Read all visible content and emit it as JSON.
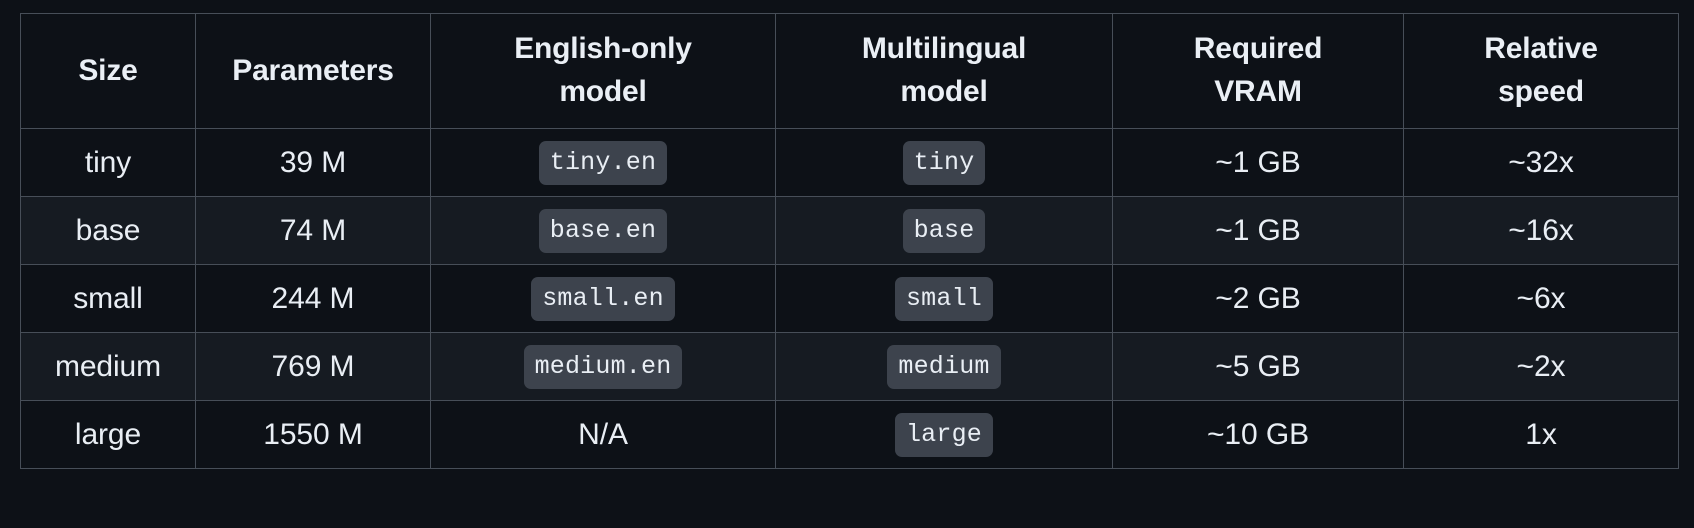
{
  "table": {
    "columns": [
      {
        "key": "size",
        "label": "Size"
      },
      {
        "key": "parameters",
        "label": "Parameters"
      },
      {
        "key": "english",
        "label": "English-only\nmodel",
        "line1": "English-only",
        "line2": "model"
      },
      {
        "key": "multilingual",
        "label": "Multilingual\nmodel",
        "line1": "Multilingual",
        "line2": "model"
      },
      {
        "key": "vram",
        "label": "Required\nVRAM",
        "line1": "Required",
        "line2": "VRAM"
      },
      {
        "key": "speed",
        "label": "Relative\nspeed",
        "line1": "Relative",
        "line2": "speed"
      }
    ],
    "rows": [
      {
        "size": "tiny",
        "parameters": "39 M",
        "english": "tiny.en",
        "english_is_code": true,
        "multilingual": "tiny",
        "multilingual_is_code": true,
        "vram": "~1 GB",
        "speed": "~32x"
      },
      {
        "size": "base",
        "parameters": "74 M",
        "english": "base.en",
        "english_is_code": true,
        "multilingual": "base",
        "multilingual_is_code": true,
        "vram": "~1 GB",
        "speed": "~16x"
      },
      {
        "size": "small",
        "parameters": "244 M",
        "english": "small.en",
        "english_is_code": true,
        "multilingual": "small",
        "multilingual_is_code": true,
        "vram": "~2 GB",
        "speed": "~6x"
      },
      {
        "size": "medium",
        "parameters": "769 M",
        "english": "medium.en",
        "english_is_code": true,
        "multilingual": "medium",
        "multilingual_is_code": true,
        "vram": "~5 GB",
        "speed": "~2x"
      },
      {
        "size": "large",
        "parameters": "1550 M",
        "english": "N/A",
        "english_is_code": false,
        "multilingual": "large",
        "multilingual_is_code": true,
        "vram": "~10 GB",
        "speed": "1x"
      }
    ]
  },
  "colors": {
    "page_background": "#0d1117",
    "row_background_odd": "#0d1117",
    "row_background_even": "#161b22",
    "border": "#474e58",
    "text": "#e9eef4",
    "header_text": "#eaeff5",
    "code_badge_background": "#3d434d"
  }
}
